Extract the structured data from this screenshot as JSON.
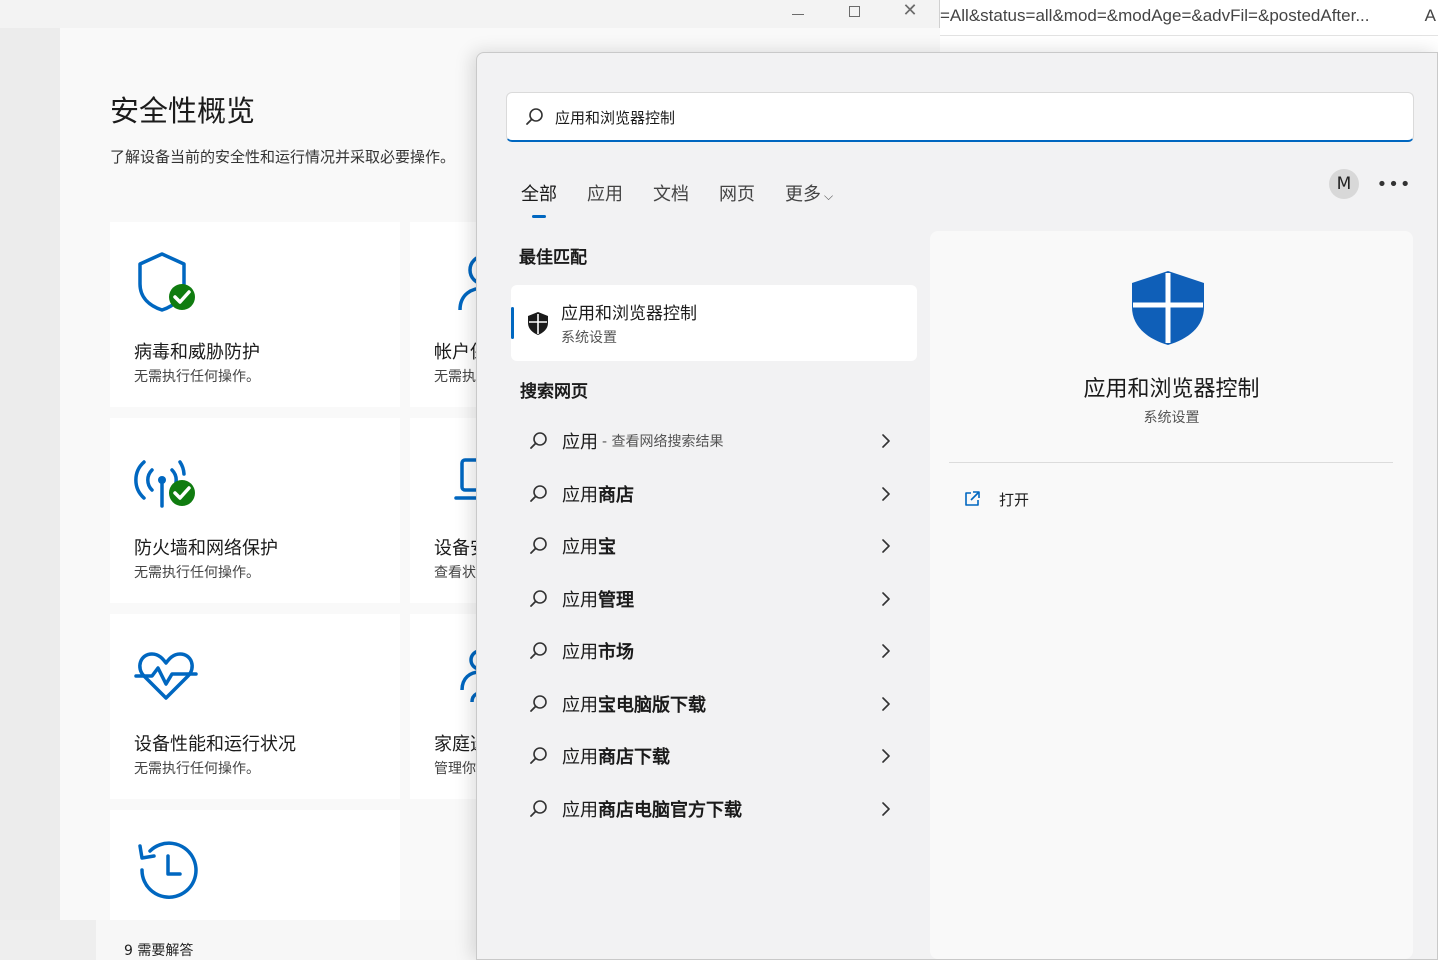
{
  "browser": {
    "url_fragment": "=All&status=all&mod=&modAge=&advFil=&postedAfter...",
    "url_trailing": "A"
  },
  "security": {
    "title": "安全性概览",
    "subtitle": "了解设备当前的安全性和运行情况并采取必要操作。",
    "cards": [
      {
        "title": "病毒和威胁防护",
        "desc": "无需执行任何操作。",
        "icon": "shield-check-icon"
      },
      {
        "title": "帐户保护",
        "desc": "无需执行任何操作。",
        "icon": "person-check-icon"
      },
      {
        "title": "防火墙和网络保护",
        "desc": "无需执行任何操作。",
        "icon": "wifi-check-icon"
      },
      {
        "title": "设备安全性",
        "desc": "查看状态。",
        "icon": "laptop-icon"
      },
      {
        "title": "设备性能和运行状况",
        "desc": "无需执行任何操作。",
        "icon": "heart-pulse-icon"
      },
      {
        "title": "家庭选项",
        "desc": "管理你的家人使用设备的方式。",
        "icon": "family-icon"
      },
      {
        "title": "",
        "desc": "",
        "icon": "history-icon"
      }
    ],
    "status_line": "9 需要解答"
  },
  "search": {
    "query": "应用和浏览器控制",
    "tabs": [
      "全部",
      "应用",
      "文档",
      "网页",
      "更多"
    ],
    "active_tab": "全部",
    "avatar_initial": "M",
    "best_match_header": "最佳匹配",
    "best_match": {
      "title": "应用和浏览器控制",
      "subtitle": "系统设置"
    },
    "web_header": "搜索网页",
    "web_results": [
      {
        "prefix": "应用",
        "bold": "",
        "hint": "- 查看网络搜索结果"
      },
      {
        "prefix": "应用",
        "bold": "商店",
        "hint": ""
      },
      {
        "prefix": "应用",
        "bold": "宝",
        "hint": ""
      },
      {
        "prefix": "应用",
        "bold": "管理",
        "hint": ""
      },
      {
        "prefix": "应用",
        "bold": "市场",
        "hint": ""
      },
      {
        "prefix": "应用",
        "bold": "宝电脑版下载",
        "hint": ""
      },
      {
        "prefix": "应用",
        "bold": "商店下载",
        "hint": ""
      },
      {
        "prefix": "应用",
        "bold": "商店电脑官方下载",
        "hint": ""
      }
    ],
    "detail": {
      "title": "应用和浏览器控制",
      "subtitle": "系统设置",
      "open_label": "打开"
    }
  },
  "colors": {
    "accent": "#0067c0",
    "check_green": "#107c10",
    "shield_blue": "#0f5fb8"
  }
}
